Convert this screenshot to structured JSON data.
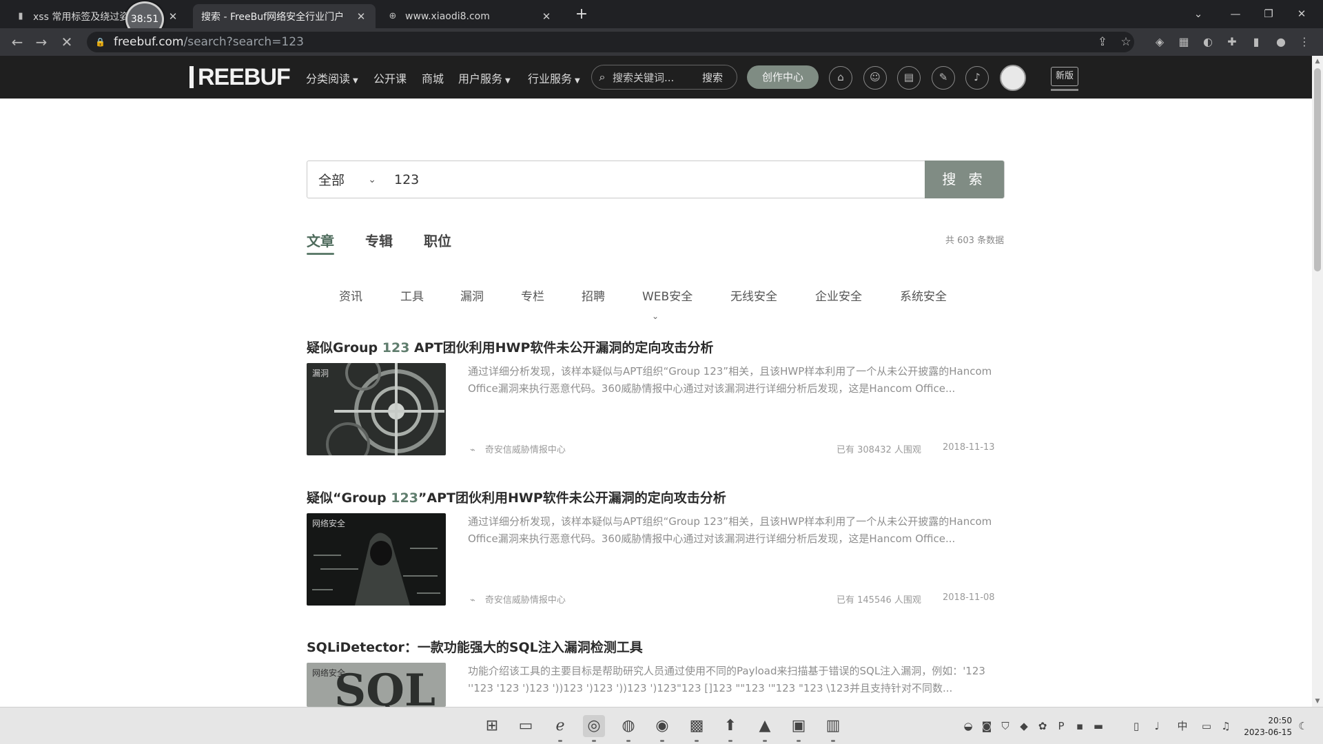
{
  "browser": {
    "tabs": [
      {
        "title": "xss 常用标签及绕过姿",
        "active": false
      },
      {
        "title": "搜索 - FreeBuf网络安全行业门户",
        "active": true
      },
      {
        "title": "www.xiaodi8.com",
        "active": false
      }
    ],
    "timer_badge": "38:51",
    "address": {
      "host": "freebuf.com",
      "path": "/search?search=123"
    }
  },
  "site_header": {
    "logo": "REEBUF",
    "nav": [
      {
        "label": "分类阅读",
        "has_menu": true
      },
      {
        "label": "公开课",
        "has_menu": false
      },
      {
        "label": "商城",
        "has_menu": false
      },
      {
        "label": "用户服务",
        "has_menu": true
      },
      {
        "label": "行业服务",
        "has_menu": true
      }
    ],
    "search_placeholder": "搜索关键词...",
    "search_button": "搜索",
    "create_button": "创作中心",
    "new_badge": "新版"
  },
  "search": {
    "scope": "全部",
    "query": "123",
    "button": "搜 索"
  },
  "main_tabs": [
    {
      "label": "文章",
      "active": true
    },
    {
      "label": "专辑",
      "active": false
    },
    {
      "label": "职位",
      "active": false
    }
  ],
  "result_count": "共 603 条数据",
  "categories": [
    "资讯",
    "工具",
    "漏洞",
    "专栏",
    "招聘",
    "WEB安全",
    "无线安全",
    "企业安全",
    "系统安全"
  ],
  "articles": [
    {
      "title_pre": "疑似Group ",
      "title_kw": "123",
      "title_post": " APT团伙利用HWP软件未公开漏洞的定向攻击分析",
      "thumb_tag": "漏洞",
      "summary": "通过详细分析发现，该样本疑似与APT组织“Group 123”相关，且该HWP样本利用了一个从未公开披露的Hancom Office漏洞来执行恶意代码。360威胁情报中心通过对该漏洞进行详细分析后发现，这是Hancom Office...",
      "author": "奇安信威胁情报中心",
      "views": "已有 308432 人围观",
      "date": "2018-11-13"
    },
    {
      "title_pre": "疑似“Group ",
      "title_kw": "123",
      "title_post": "”APT团伙利用HWP软件未公开漏洞的定向攻击分析",
      "thumb_tag": "网络安全",
      "summary": "通过详细分析发现，该样本疑似与APT组织“Group 123”相关，且该HWP样本利用了一个从未公开披露的Hancom Office漏洞来执行恶意代码。360威胁情报中心通过对该漏洞进行详细分析后发现，这是Hancom Office...",
      "author": "奇安信威胁情报中心",
      "views": "已有 145546 人围观",
      "date": "2018-11-08"
    },
    {
      "title_pre": "SQLiDetector：一款功能强大的SQL注入漏洞检测工具",
      "title_kw": "",
      "title_post": "",
      "thumb_tag": "网络安全",
      "summary": "功能介绍该工具的主要目标是帮助研究人员通过使用不同的Payload来扫描基于错误的SQL注入漏洞，例如：'123 ''123 '123 ')123 '))123 ')123 '))123 ')123\"123 []123 \"\"123 '\"123 \"123 \\123并且支持针对不同数...",
      "author": "",
      "views": "",
      "date": ""
    }
  ],
  "taskbar": {
    "clock_time": "20:50",
    "clock_date": "2023-06-15",
    "ime": "中"
  }
}
